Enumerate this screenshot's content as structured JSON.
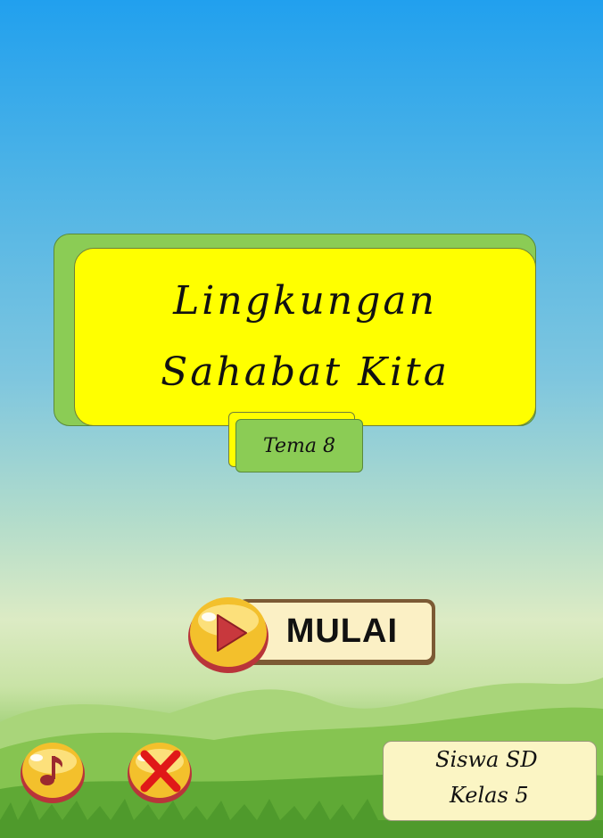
{
  "title": {
    "line1": "Lingkungan",
    "line2": "Sahabat Kita"
  },
  "theme_badge": "Tema 8",
  "start_button": {
    "label": "MULAI",
    "icon": "play-icon"
  },
  "music_button": {
    "icon": "music-note-icon"
  },
  "exit_button": {
    "icon": "close-x-icon"
  },
  "info": {
    "line1": "Siswa SD",
    "line2": "Kelas 5"
  },
  "colors": {
    "title_yellow": "#ffff00",
    "title_green": "#8bcc55",
    "button_gold": "#f3c02c",
    "button_red": "#b9343a",
    "button_brown": "#7c5a34"
  }
}
